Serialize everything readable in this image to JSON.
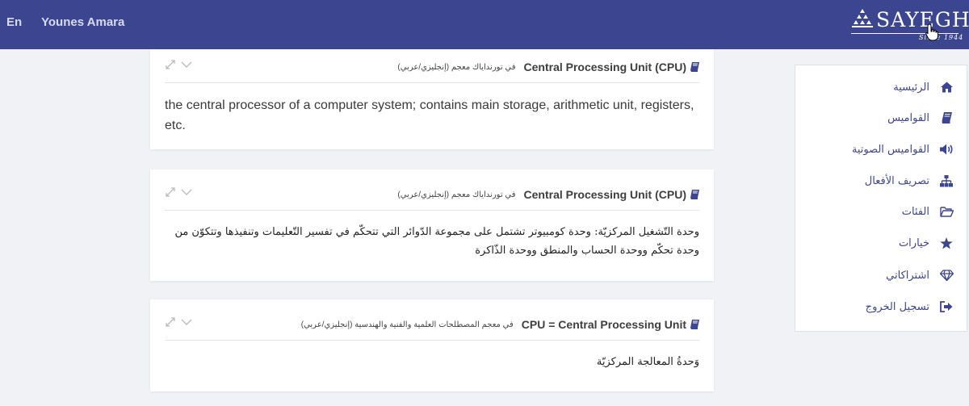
{
  "header": {
    "language": "En",
    "user_name": "Younes Amara",
    "logo": {
      "name": "SAYEGH",
      "since": "Since 1944"
    }
  },
  "cards": [
    {
      "term": "Central Processing Unit (CPU)",
      "source": "في تورنداياك معجم (إنجليزي/عربي)",
      "body": "the central processor of a computer system; contains main storage, arithmetic unit, registers, etc.",
      "lang": "en"
    },
    {
      "term": "Central Processing Unit (CPU)",
      "source": "في تورنداياك معجم (إنجليزي/عربي)",
      "body": "وحدة التّشغيل المركزيّة: وحدة كومبيوتر تشتمل على مجموعة الدّوائر التي تتحكّم في تفسير التّعليمات وتنفيذها وتتكوّن من وحدة تحكّم ووحدة الحساب والمنطق ووحدة الذّاكرة",
      "lang": "ar"
    },
    {
      "term": "CPU = Central Processing Unit",
      "source": "في معجم المصطلحات العلمية والفنية والهندسية (إنجليزي/عربي)",
      "body": "وَحدةُ المعالجة المركزيّة",
      "lang": "ar"
    }
  ],
  "sidebar": {
    "items": [
      {
        "label": "الرئيسية",
        "icon": "home-icon"
      },
      {
        "label": "القواميس",
        "icon": "book-icon"
      },
      {
        "label": "القواميس الصوتية",
        "icon": "speaker-icon"
      },
      {
        "label": "تصريف الأفعال",
        "icon": "sitemap-icon"
      },
      {
        "label": "الفئات",
        "icon": "folder-icon"
      },
      {
        "label": "خيارات",
        "icon": "star-icon"
      },
      {
        "label": "اشتراكاتي",
        "icon": "diamond-icon"
      },
      {
        "label": "تسجيل الخروج",
        "icon": "sign-out-icon"
      }
    ]
  },
  "colors": {
    "header_bg": "#3c4690",
    "accent": "#3c4690",
    "page_bg": "#f1f2f5"
  }
}
